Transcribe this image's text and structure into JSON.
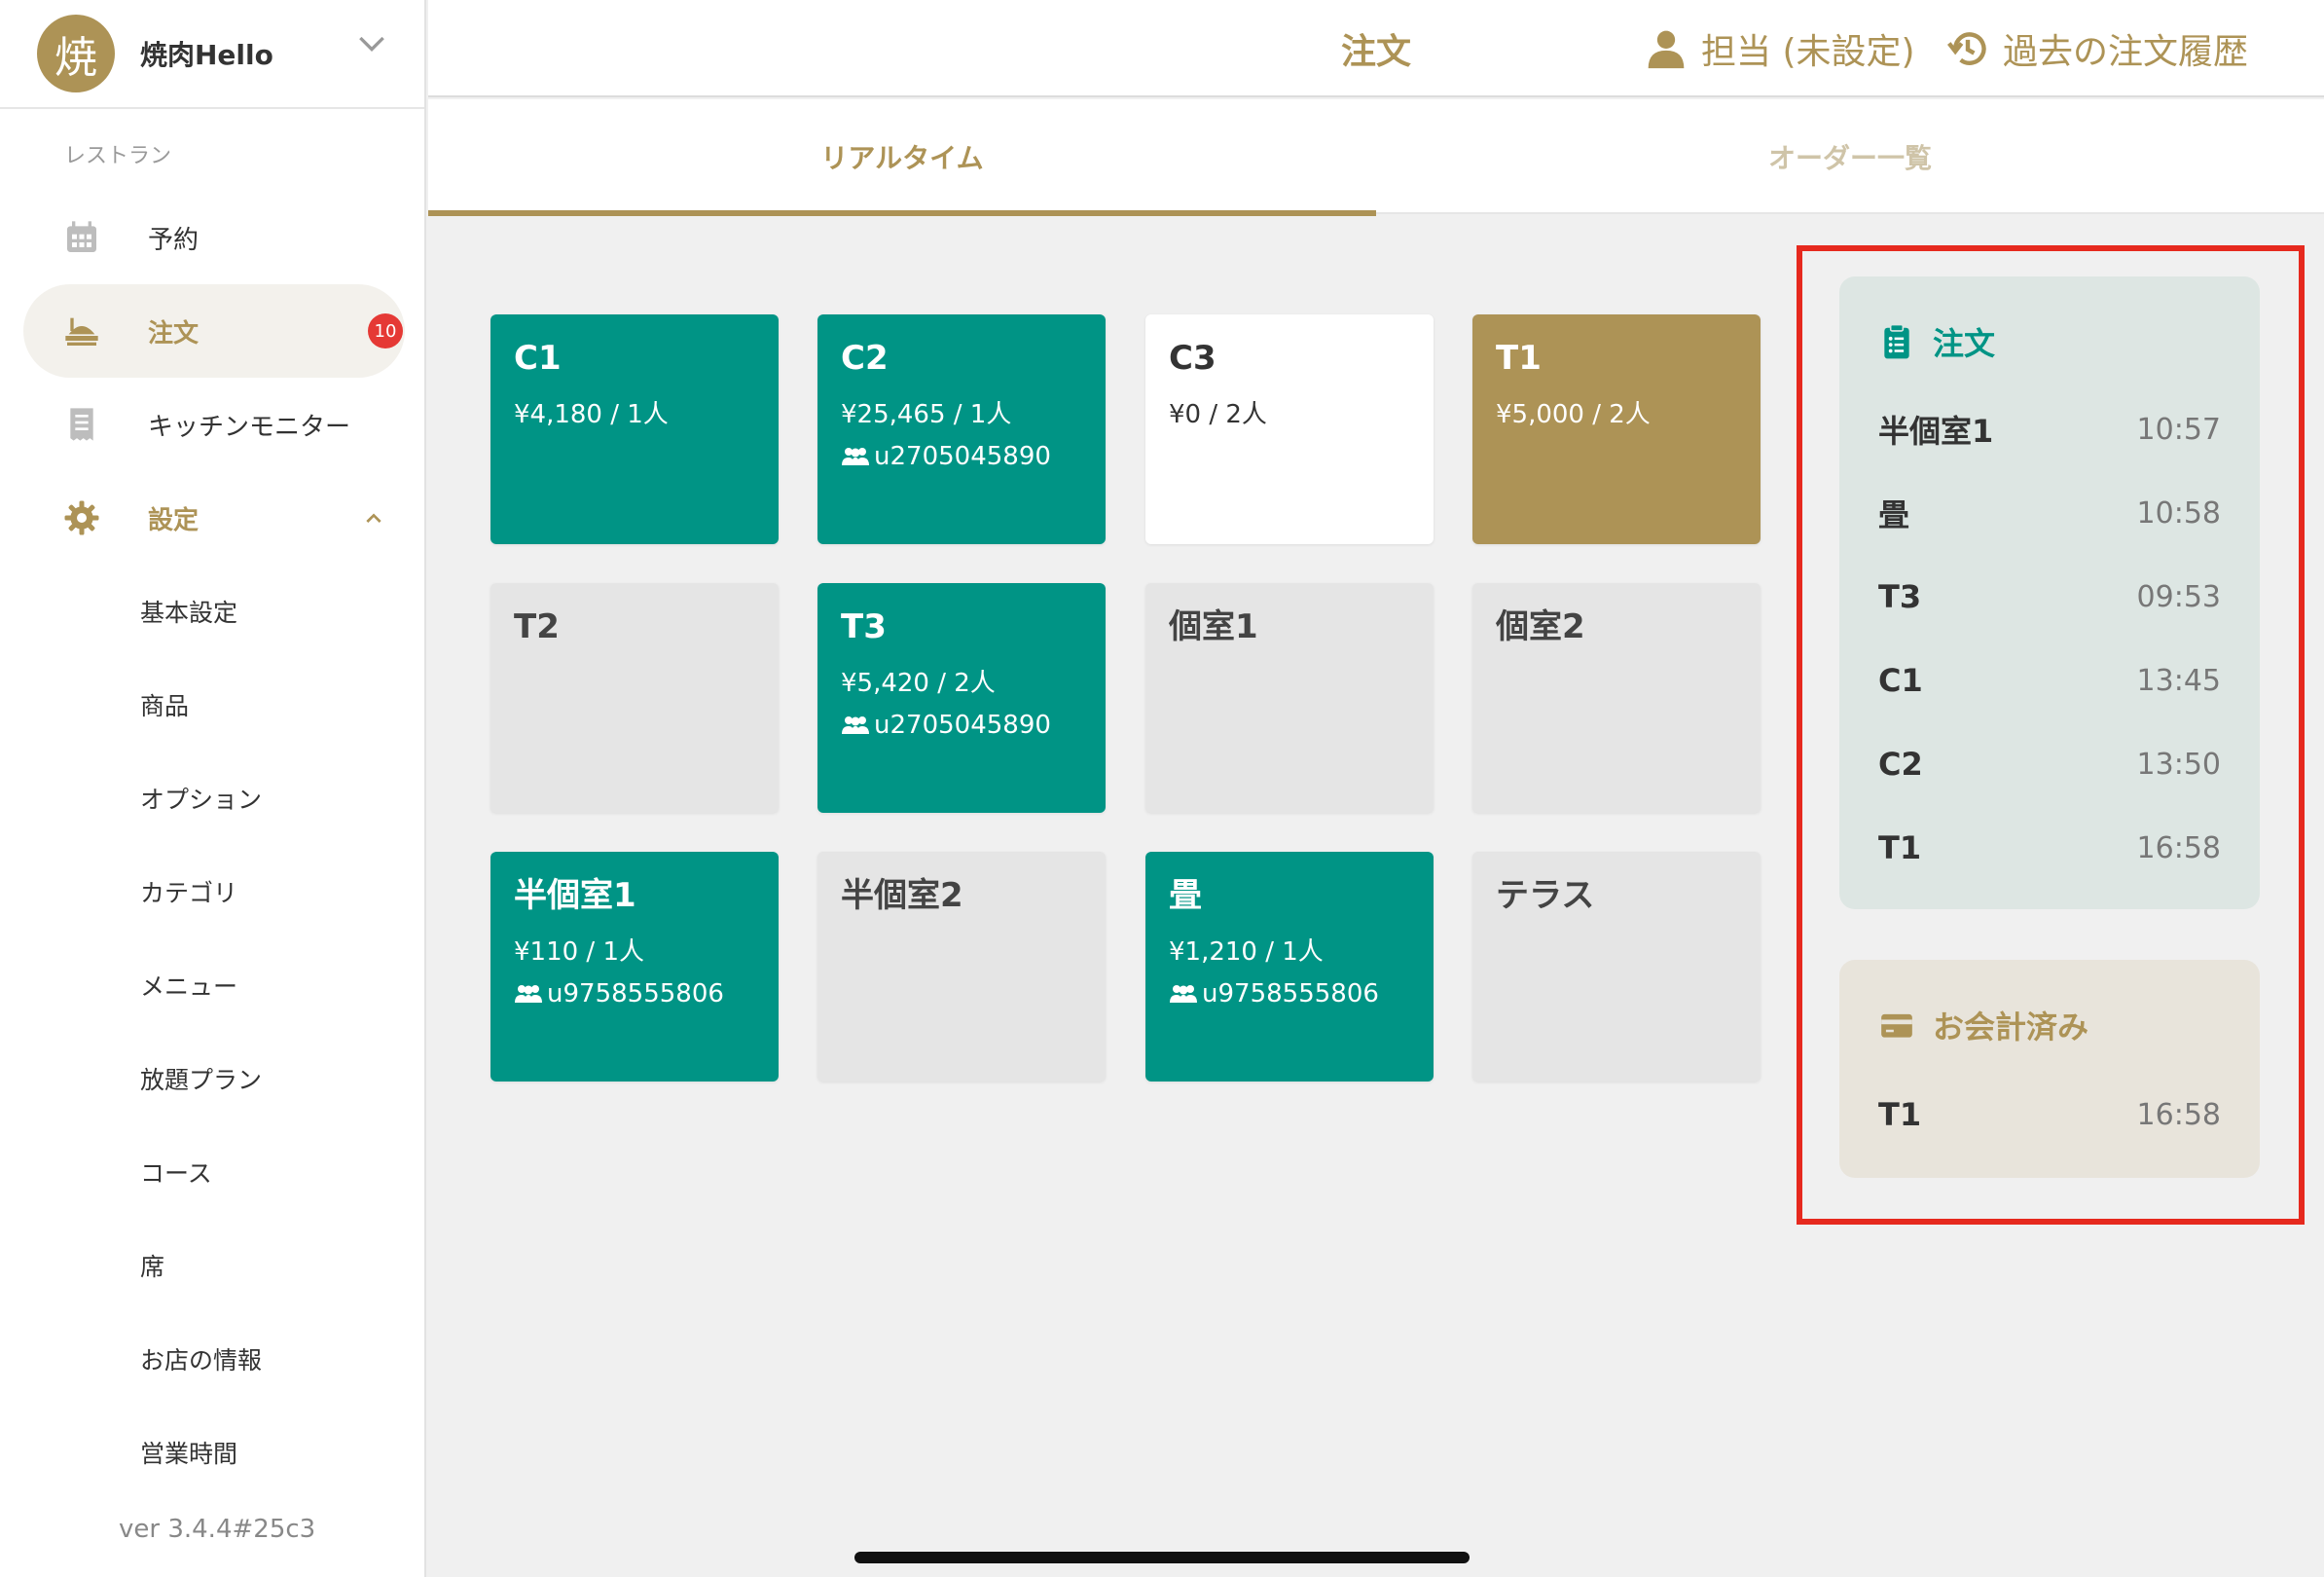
{
  "brand": {
    "avatar_char": "焼",
    "name": "焼肉Hello"
  },
  "sidebar": {
    "section_label": "レストラン",
    "items": [
      {
        "label": "予約",
        "icon": "calendar-icon"
      },
      {
        "label": "注文",
        "icon": "order-tray-icon",
        "badge": "10"
      },
      {
        "label": "キッチンモニター",
        "icon": "receipt-icon"
      },
      {
        "label": "設定",
        "icon": "gear-icon"
      }
    ],
    "settings_children": [
      "基本設定",
      "商品",
      "オプション",
      "カテゴリ",
      "メニュー",
      "放題プラン",
      "コース",
      "席",
      "お店の情報",
      "営業時間"
    ],
    "version": "ver 3.4.4#25c3"
  },
  "header": {
    "title": "注文",
    "staff_label": "担当 (未設定)",
    "history_label": "過去の注文履歴"
  },
  "tabs": [
    {
      "label": "リアルタイム",
      "active": true
    },
    {
      "label": "オーダー一覧",
      "active": false
    }
  ],
  "tables": [
    {
      "name": "C1",
      "info": "¥4,180 / 1人",
      "user": "",
      "state": "teal"
    },
    {
      "name": "C2",
      "info": "¥25,465 / 1人",
      "user": "u2705045890",
      "state": "teal"
    },
    {
      "name": "C3",
      "info": "¥0 / 2人",
      "user": "",
      "state": "white"
    },
    {
      "name": "T1",
      "info": "¥5,000 / 2人",
      "user": "",
      "state": "gold"
    },
    {
      "name": "T2",
      "info": "",
      "user": "",
      "state": "empty"
    },
    {
      "name": "T3",
      "info": "¥5,420 / 2人",
      "user": "u2705045890",
      "state": "teal"
    },
    {
      "name": "個室1",
      "info": "",
      "user": "",
      "state": "empty"
    },
    {
      "name": "個室2",
      "info": "",
      "user": "",
      "state": "empty"
    },
    {
      "name": "半個室1",
      "info": "¥110 / 1人",
      "user": "u9758555806",
      "state": "teal"
    },
    {
      "name": "半個室2",
      "info": "",
      "user": "",
      "state": "empty"
    },
    {
      "name": "畳",
      "info": "¥1,210 / 1人",
      "user": "u9758555806",
      "state": "teal"
    },
    {
      "name": "テラス",
      "info": "",
      "user": "",
      "state": "empty"
    }
  ],
  "orders_panel": {
    "title": "注文",
    "rows": [
      {
        "name": "半個室1",
        "time": "10:57"
      },
      {
        "name": "畳",
        "time": "10:58"
      },
      {
        "name": "T3",
        "time": "09:53"
      },
      {
        "name": "C1",
        "time": "13:45"
      },
      {
        "name": "C2",
        "time": "13:50"
      },
      {
        "name": "T1",
        "time": "16:58"
      }
    ]
  },
  "paid_panel": {
    "title": "お会計済み",
    "rows": [
      {
        "name": "T1",
        "time": "16:58"
      }
    ]
  },
  "colors": {
    "gold": "#ad9356",
    "teal": "#009485",
    "highlight": "#e6291e",
    "badge": "#e53935"
  }
}
